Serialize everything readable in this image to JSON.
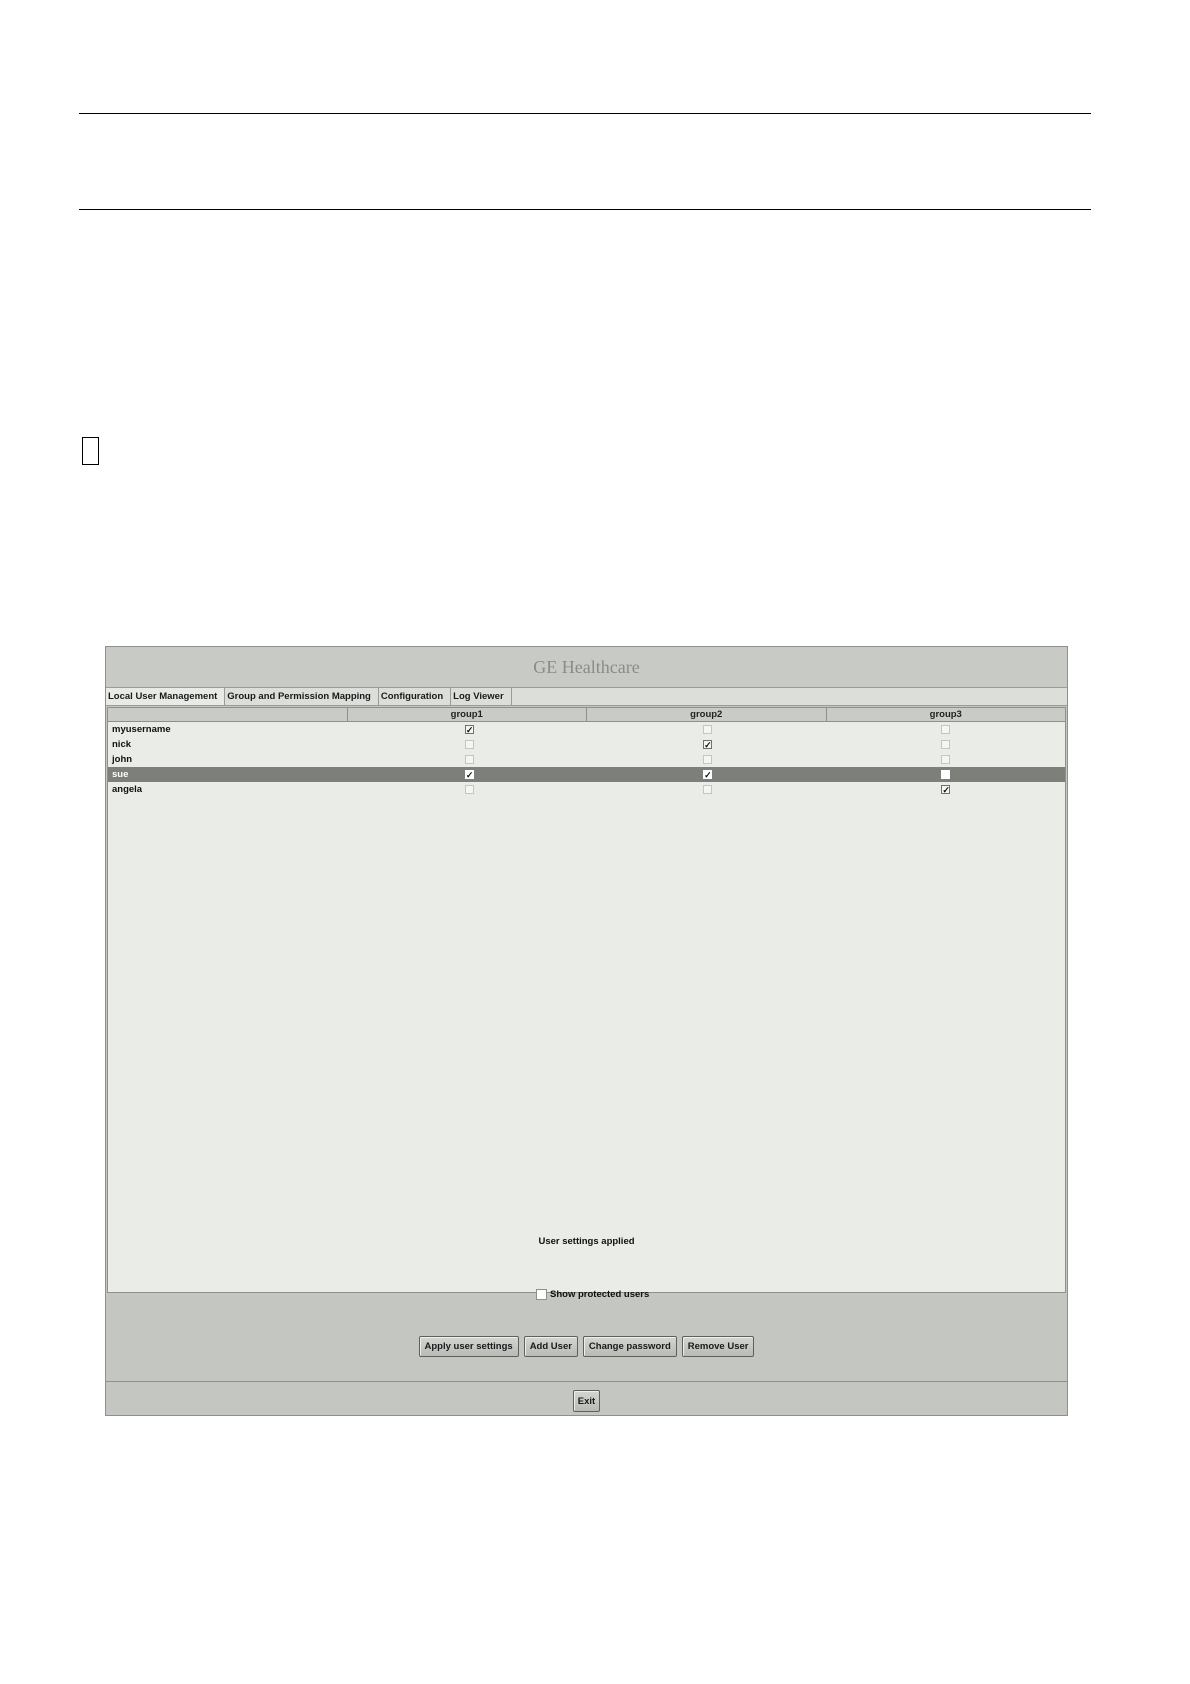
{
  "app": {
    "banner_title": "GE Healthcare",
    "tabs": [
      {
        "label": "Local User Management"
      },
      {
        "label": "Group and Permission Mapping"
      },
      {
        "label": "Configuration"
      },
      {
        "label": "Log Viewer"
      }
    ],
    "table": {
      "columns": [
        "",
        "group1",
        "group2",
        "group3"
      ],
      "rows": [
        {
          "name": "myusername",
          "groups": [
            true,
            false,
            false
          ]
        },
        {
          "name": "nick",
          "groups": [
            false,
            true,
            false
          ]
        },
        {
          "name": "john",
          "groups": [
            false,
            false,
            false
          ]
        },
        {
          "name": "sue",
          "groups": [
            true,
            true,
            false
          ],
          "selected": true
        },
        {
          "name": "angela",
          "groups": [
            false,
            false,
            true
          ]
        }
      ]
    },
    "status_text": "User settings applied",
    "show_protected_label": "Show protected users",
    "buttons": {
      "apply": "Apply user settings",
      "add": "Add User",
      "change_password": "Change password",
      "remove": "Remove User",
      "exit": "Exit"
    }
  }
}
